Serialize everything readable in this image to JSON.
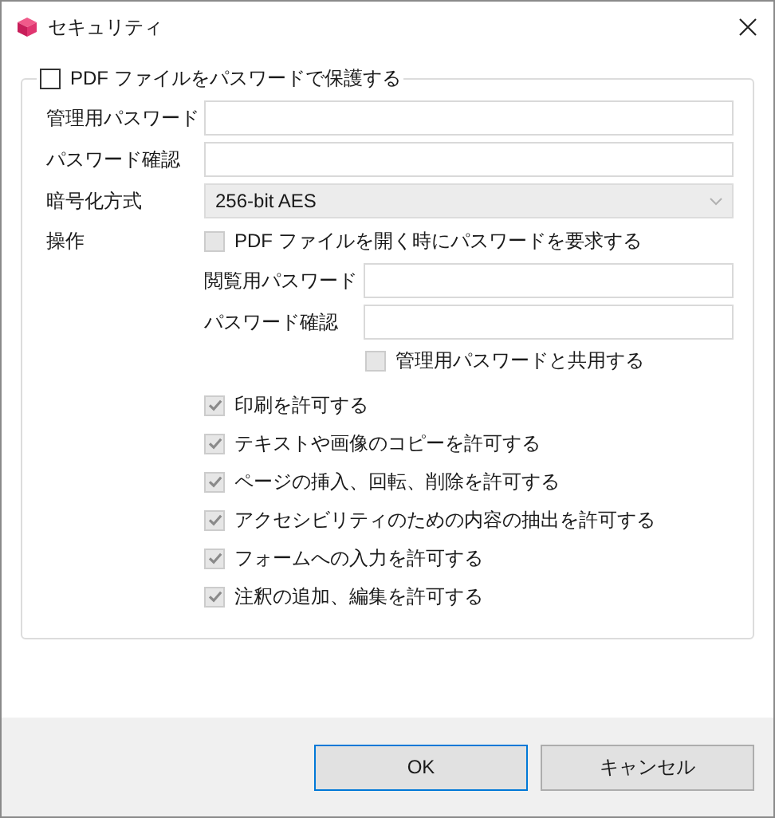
{
  "window": {
    "title": "セキュリティ"
  },
  "protect": {
    "label": "PDF ファイルをパスワードで保護する",
    "checked": false
  },
  "fields": [
    {
      "kind": "text",
      "label": "管理用パスワード"
    },
    {
      "kind": "text",
      "label": "パスワード確認"
    },
    {
      "kind": "select",
      "label": "暗号化方式",
      "value": "256-bit AES",
      "disabled": true
    }
  ],
  "operations": {
    "label": "操作",
    "require_open": {
      "label": "PDF ファイルを開く時にパスワードを要求する",
      "checked": false,
      "disabled": true
    },
    "open_fields": [
      {
        "label": "閲覧用パスワード"
      },
      {
        "label": "パスワード確認"
      }
    ],
    "share": {
      "label": "管理用パスワードと共用する",
      "checked": false,
      "disabled": true
    },
    "permissions": [
      {
        "label": "印刷を許可する",
        "checked": true,
        "disabled": true
      },
      {
        "label": "テキストや画像のコピーを許可する",
        "checked": true,
        "disabled": true
      },
      {
        "label": "ページの挿入、回転、削除を許可する",
        "checked": true,
        "disabled": true
      },
      {
        "label": "アクセシビリティのための内容の抽出を許可する",
        "checked": true,
        "disabled": true
      },
      {
        "label": "フォームへの入力を許可する",
        "checked": true,
        "disabled": true
      },
      {
        "label": "注釈の追加、編集を許可する",
        "checked": true,
        "disabled": true
      }
    ]
  },
  "buttons": [
    {
      "label": "OK",
      "default": true
    },
    {
      "label": "キャンセル",
      "default": false
    }
  ]
}
